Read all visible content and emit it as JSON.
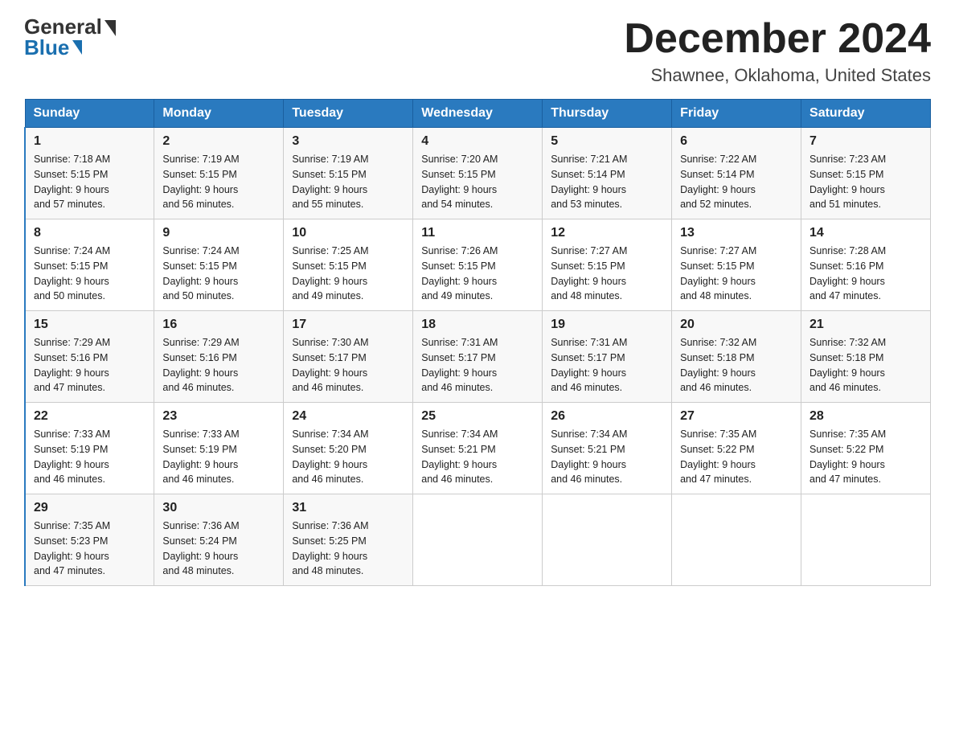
{
  "header": {
    "logo_general": "General",
    "logo_blue": "Blue",
    "month_title": "December 2024",
    "location": "Shawnee, Oklahoma, United States"
  },
  "weekdays": [
    "Sunday",
    "Monday",
    "Tuesday",
    "Wednesday",
    "Thursday",
    "Friday",
    "Saturday"
  ],
  "weeks": [
    [
      {
        "day": "1",
        "sunrise": "7:18 AM",
        "sunset": "5:15 PM",
        "daylight": "9 hours and 57 minutes."
      },
      {
        "day": "2",
        "sunrise": "7:19 AM",
        "sunset": "5:15 PM",
        "daylight": "9 hours and 56 minutes."
      },
      {
        "day": "3",
        "sunrise": "7:19 AM",
        "sunset": "5:15 PM",
        "daylight": "9 hours and 55 minutes."
      },
      {
        "day": "4",
        "sunrise": "7:20 AM",
        "sunset": "5:15 PM",
        "daylight": "9 hours and 54 minutes."
      },
      {
        "day": "5",
        "sunrise": "7:21 AM",
        "sunset": "5:14 PM",
        "daylight": "9 hours and 53 minutes."
      },
      {
        "day": "6",
        "sunrise": "7:22 AM",
        "sunset": "5:14 PM",
        "daylight": "9 hours and 52 minutes."
      },
      {
        "day": "7",
        "sunrise": "7:23 AM",
        "sunset": "5:15 PM",
        "daylight": "9 hours and 51 minutes."
      }
    ],
    [
      {
        "day": "8",
        "sunrise": "7:24 AM",
        "sunset": "5:15 PM",
        "daylight": "9 hours and 50 minutes."
      },
      {
        "day": "9",
        "sunrise": "7:24 AM",
        "sunset": "5:15 PM",
        "daylight": "9 hours and 50 minutes."
      },
      {
        "day": "10",
        "sunrise": "7:25 AM",
        "sunset": "5:15 PM",
        "daylight": "9 hours and 49 minutes."
      },
      {
        "day": "11",
        "sunrise": "7:26 AM",
        "sunset": "5:15 PM",
        "daylight": "9 hours and 49 minutes."
      },
      {
        "day": "12",
        "sunrise": "7:27 AM",
        "sunset": "5:15 PM",
        "daylight": "9 hours and 48 minutes."
      },
      {
        "day": "13",
        "sunrise": "7:27 AM",
        "sunset": "5:15 PM",
        "daylight": "9 hours and 48 minutes."
      },
      {
        "day": "14",
        "sunrise": "7:28 AM",
        "sunset": "5:16 PM",
        "daylight": "9 hours and 47 minutes."
      }
    ],
    [
      {
        "day": "15",
        "sunrise": "7:29 AM",
        "sunset": "5:16 PM",
        "daylight": "9 hours and 47 minutes."
      },
      {
        "day": "16",
        "sunrise": "7:29 AM",
        "sunset": "5:16 PM",
        "daylight": "9 hours and 46 minutes."
      },
      {
        "day": "17",
        "sunrise": "7:30 AM",
        "sunset": "5:17 PM",
        "daylight": "9 hours and 46 minutes."
      },
      {
        "day": "18",
        "sunrise": "7:31 AM",
        "sunset": "5:17 PM",
        "daylight": "9 hours and 46 minutes."
      },
      {
        "day": "19",
        "sunrise": "7:31 AM",
        "sunset": "5:17 PM",
        "daylight": "9 hours and 46 minutes."
      },
      {
        "day": "20",
        "sunrise": "7:32 AM",
        "sunset": "5:18 PM",
        "daylight": "9 hours and 46 minutes."
      },
      {
        "day": "21",
        "sunrise": "7:32 AM",
        "sunset": "5:18 PM",
        "daylight": "9 hours and 46 minutes."
      }
    ],
    [
      {
        "day": "22",
        "sunrise": "7:33 AM",
        "sunset": "5:19 PM",
        "daylight": "9 hours and 46 minutes."
      },
      {
        "day": "23",
        "sunrise": "7:33 AM",
        "sunset": "5:19 PM",
        "daylight": "9 hours and 46 minutes."
      },
      {
        "day": "24",
        "sunrise": "7:34 AM",
        "sunset": "5:20 PM",
        "daylight": "9 hours and 46 minutes."
      },
      {
        "day": "25",
        "sunrise": "7:34 AM",
        "sunset": "5:21 PM",
        "daylight": "9 hours and 46 minutes."
      },
      {
        "day": "26",
        "sunrise": "7:34 AM",
        "sunset": "5:21 PM",
        "daylight": "9 hours and 46 minutes."
      },
      {
        "day": "27",
        "sunrise": "7:35 AM",
        "sunset": "5:22 PM",
        "daylight": "9 hours and 47 minutes."
      },
      {
        "day": "28",
        "sunrise": "7:35 AM",
        "sunset": "5:22 PM",
        "daylight": "9 hours and 47 minutes."
      }
    ],
    [
      {
        "day": "29",
        "sunrise": "7:35 AM",
        "sunset": "5:23 PM",
        "daylight": "9 hours and 47 minutes."
      },
      {
        "day": "30",
        "sunrise": "7:36 AM",
        "sunset": "5:24 PM",
        "daylight": "9 hours and 48 minutes."
      },
      {
        "day": "31",
        "sunrise": "7:36 AM",
        "sunset": "5:25 PM",
        "daylight": "9 hours and 48 minutes."
      },
      null,
      null,
      null,
      null
    ]
  ],
  "labels": {
    "sunrise": "Sunrise:",
    "sunset": "Sunset:",
    "daylight": "Daylight:"
  }
}
